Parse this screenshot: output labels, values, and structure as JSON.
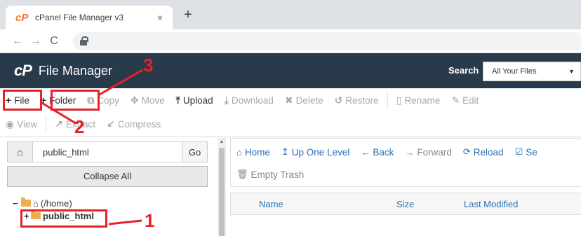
{
  "browser": {
    "tab_title": "cPanel File Manager v3",
    "tab_logo": "cP",
    "close_glyph": "×",
    "new_tab_glyph": "+",
    "nav_back_glyph": "←",
    "nav_forward_glyph": "→",
    "reload_glyph": "C"
  },
  "header": {
    "logo": "cP",
    "title": "File Manager",
    "search_label": "Search",
    "search_option": "All Your Files",
    "search_caret": "▼"
  },
  "toolbar": {
    "row1": [
      {
        "icon": "+",
        "label": "File"
      },
      {
        "icon": "+",
        "label": "Folder"
      },
      {
        "icon": "⧉",
        "label": "Copy"
      },
      {
        "icon": "✥",
        "label": "Move"
      },
      {
        "icon": "⤒",
        "label": "Upload"
      },
      {
        "icon": "⤓",
        "label": "Download"
      },
      {
        "icon": "✖",
        "label": "Delete"
      },
      {
        "icon": "↺",
        "label": "Restore"
      },
      {
        "icon": "▯",
        "label": "Rename"
      },
      {
        "icon": "✎",
        "label": "Edit"
      }
    ],
    "row2": [
      {
        "icon": "◉",
        "label": "View"
      },
      {
        "icon": "↗",
        "label": "Extract"
      },
      {
        "icon": "↙",
        "label": "Compress"
      }
    ]
  },
  "left": {
    "path_value": "public_html",
    "home_glyph": "⌂",
    "go_label": "Go",
    "collapse_label": "Collapse All",
    "tree_root": "(/home)",
    "tree_root_prefix": "−",
    "tree_child": "public_html",
    "tree_child_prefix": "+",
    "scroll_up_glyph": "▲"
  },
  "right": {
    "actions_row1": [
      {
        "icon": "⌂",
        "label": "Home"
      },
      {
        "icon": "↥",
        "label": "Up One Level"
      },
      {
        "icon": "←",
        "label": "Back"
      },
      {
        "icon": "→",
        "label": "Forward"
      },
      {
        "icon": "⟳",
        "label": "Reload"
      },
      {
        "icon": "☑",
        "label": "Se"
      }
    ],
    "actions_row2": [
      {
        "icon": "🗑",
        "label": "Empty Trash"
      }
    ],
    "columns": [
      "Name",
      "Size",
      "Last Modified"
    ]
  },
  "annotations": {
    "one": "1",
    "two": "2",
    "three": "3"
  },
  "colors": {
    "header_bg": "#293a4a",
    "annotation_red": "#e8202a",
    "link_blue": "#2a6fb5",
    "folder_yellow": "#f0ad4e",
    "cpanel_orange": "#ff6c2c"
  }
}
